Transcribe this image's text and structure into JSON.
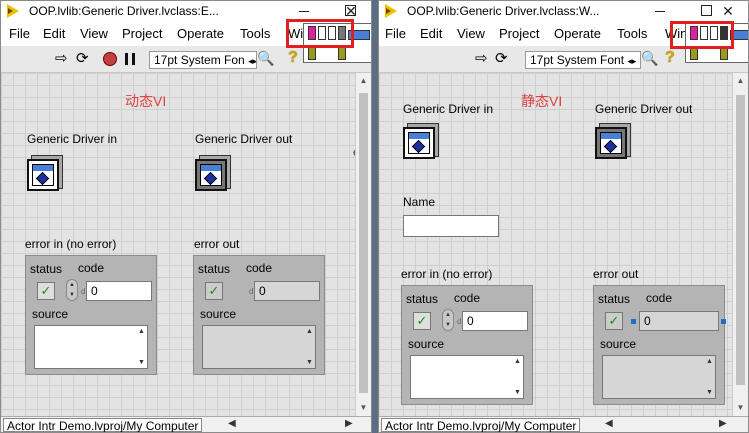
{
  "left_window": {
    "title": "OOP.lvlib:Generic Driver.lvclass:E...",
    "menu": [
      "File",
      "Edit",
      "View",
      "Project",
      "Operate",
      "Tools",
      "Win"
    ],
    "font_dropdown": "17pt System Fon",
    "panel_title": "动态VI",
    "in_label": "Generic Driver in",
    "out_label": "Generic Driver out",
    "error_in_label": "error in (no error)",
    "error_out_label": "error out",
    "status_label": "status",
    "code_label": "code",
    "source_label": "source",
    "code_in_value": "0",
    "code_out_value": "0",
    "radix": "d",
    "stray_char": "e",
    "statusbar_text": "Actor Intr Demo.lvproj/My Computer"
  },
  "right_window": {
    "title": "OOP.lvlib:Generic Driver.lvclass:W...",
    "menu": [
      "File",
      "Edit",
      "View",
      "Project",
      "Operate",
      "Tools",
      "Win"
    ],
    "font_dropdown": "17pt System Font",
    "panel_title": "静态VI",
    "in_label": "Generic Driver in",
    "out_label": "Generic Driver out",
    "name_label": "Name",
    "error_in_label": "error in (no error)",
    "error_out_label": "error out",
    "status_label": "status",
    "code_label": "code",
    "source_label": "source",
    "code_in_value": "0",
    "code_out_value": "0",
    "radix": "d",
    "statusbar_text": "Actor Intr Demo.lvproj/My Computer"
  },
  "colors": {
    "highlight": "#e02020",
    "vi_title": "#e04040",
    "check": "#1a8a1a"
  }
}
